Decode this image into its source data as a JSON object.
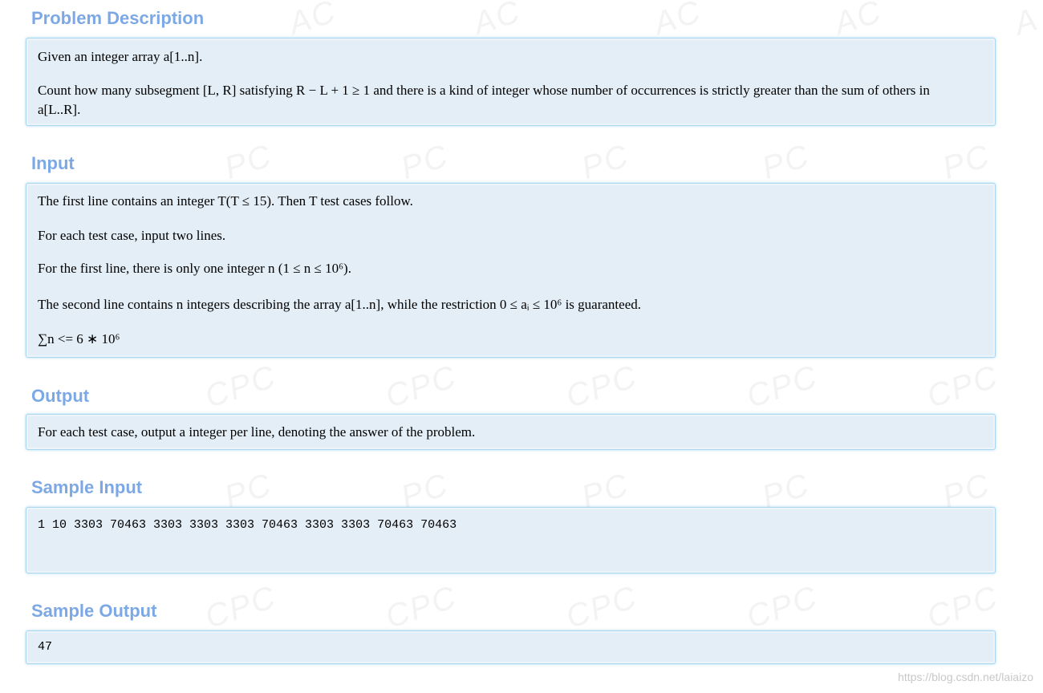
{
  "sections": {
    "description": {
      "title": "Problem Description",
      "line1": "Given an integer array a[1..n].",
      "line2": "Count how many subsegment [L, R] satisfying R − L + 1 ≥ 1 and there is a kind of integer whose number of occurrences is strictly greater than the sum of others in",
      "line3": "a[L..R]."
    },
    "input": {
      "title": "Input",
      "line1": "The first line contains an integer T(T ≤ 15). Then T test cases follow.",
      "line2": "For each test case, input two lines.",
      "line3": "For the first line, there is only one integer n (1 ≤ n ≤ 10⁶).",
      "line4": "The second line contains n integers describing the array a[1..n], while the restriction 0 ≤ aᵢ ≤ 10⁶ is guaranteed.",
      "line5": "∑n <= 6 ∗ 10⁶"
    },
    "output": {
      "title": "Output",
      "line1": "For each test case, output a integer per line, denoting the answer of the problem."
    },
    "sample_input": {
      "title": "Sample Input",
      "text": "1\n10\n3303 70463 3303 3303 3303 70463 3303 3303 70463 70463"
    },
    "sample_output": {
      "title": "Sample Output",
      "text": "47"
    }
  },
  "watermark": {
    "text": "ACPC"
  },
  "credit": "https://blog.csdn.net/laiaizo"
}
